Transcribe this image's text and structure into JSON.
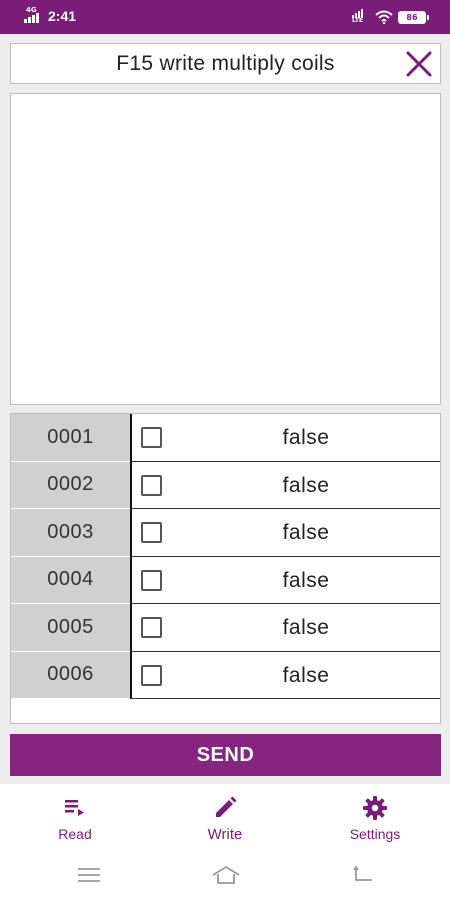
{
  "status_bar": {
    "time": "2:41",
    "network_label": "4G",
    "lte_label": "LTE",
    "battery": "86"
  },
  "header": {
    "title": "F15 write multiply coils",
    "close_icon": "close-icon"
  },
  "coils": [
    {
      "address": "0001",
      "value": "false",
      "checked": false
    },
    {
      "address": "0002",
      "value": "false",
      "checked": false
    },
    {
      "address": "0003",
      "value": "false",
      "checked": false
    },
    {
      "address": "0004",
      "value": "false",
      "checked": false
    },
    {
      "address": "0005",
      "value": "false",
      "checked": false
    },
    {
      "address": "0006",
      "value": "false",
      "checked": false
    }
  ],
  "send_label": "SEND",
  "bottom_nav": {
    "items": [
      {
        "label": "Read",
        "icon": "read-list-icon"
      },
      {
        "label": "Write",
        "icon": "pencil-icon"
      },
      {
        "label": "Settings",
        "icon": "gear-icon"
      }
    ],
    "active_index": 1
  },
  "colors": {
    "accent": "#86247f",
    "status_bar": "#7a1d78"
  }
}
